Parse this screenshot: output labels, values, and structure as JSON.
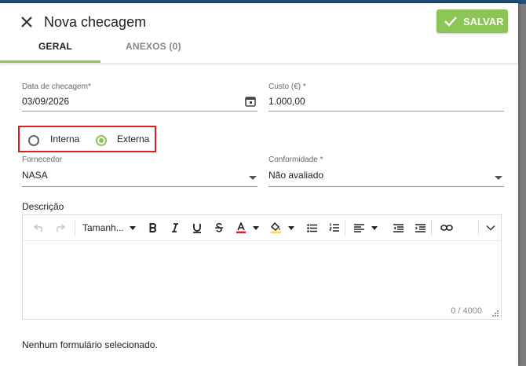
{
  "dialog": {
    "title": "Nova checagem",
    "save_label": "SALVAR",
    "accent_color": "#8dc457"
  },
  "tabs": [
    {
      "label": "GERAL",
      "active": true
    },
    {
      "label": "ANEXOS (0)",
      "active": false
    }
  ],
  "form": {
    "date": {
      "label": "Data de checagem*",
      "value": "03/09/2026",
      "icon": "calendar-icon"
    },
    "cost": {
      "label": "Custo (€) *",
      "value": "1.000,00"
    },
    "type": {
      "options": [
        {
          "label": "Interna",
          "selected": false
        },
        {
          "label": "Externa",
          "selected": true
        }
      ]
    },
    "supplier": {
      "label": "Fornecedor",
      "value": "NASA"
    },
    "conformity": {
      "label": "Conformidade *",
      "value": "Não avaliado"
    },
    "description": {
      "label": "Descrição",
      "font_size_label": "Tamanh...",
      "counter": "0 / 4000"
    }
  },
  "footer": {
    "note": "Nenhum formulário selecionado."
  },
  "icons": [
    "close-icon",
    "check-icon",
    "undo-icon",
    "redo-icon",
    "bold-icon",
    "italic-icon",
    "underline-icon",
    "strikethrough-icon",
    "font-color-icon",
    "highlight-icon",
    "bullet-list-icon",
    "numbered-list-icon",
    "align-left-icon",
    "outdent-icon",
    "indent-icon",
    "link-icon",
    "more-chevron-icon",
    "resize-handle-icon"
  ]
}
